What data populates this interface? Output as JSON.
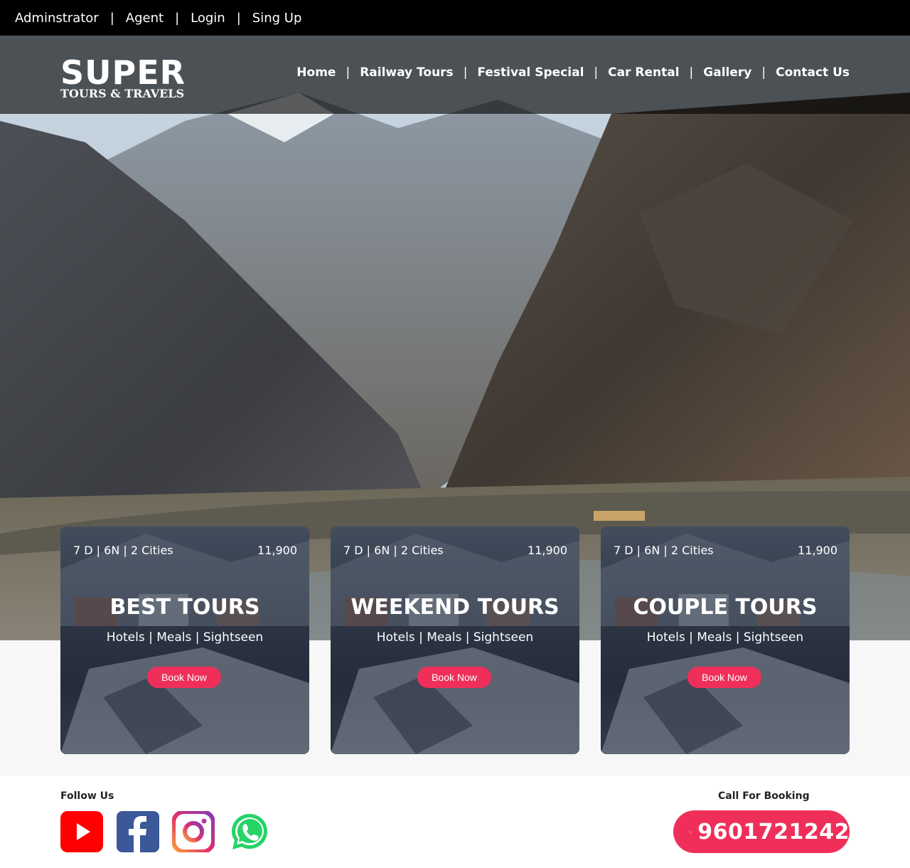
{
  "topbar": {
    "links": [
      "Adminstrator",
      "Agent",
      "Login",
      "Sing Up"
    ],
    "separator": "|"
  },
  "header": {
    "logo_main": "SUPER",
    "logo_sub": "TOURS & TRAVELS",
    "nav": [
      "Home",
      "Railway Tours",
      "Festival Special",
      "Car Rental",
      "Gallery",
      "Contact Us"
    ],
    "separator": "|"
  },
  "hero": {
    "image": "mountain-valley-photo"
  },
  "cards": [
    {
      "meta": "7 D | 6N | 2 Cities",
      "price": "11,900",
      "title": "BEST TOURS",
      "subtitle": "Hotels | Meals | Sightseen",
      "button": "Book Now"
    },
    {
      "meta": "7 D | 6N | 2 Cities",
      "price": "11,900",
      "title": "WEEKEND TOURS",
      "subtitle": "Hotels | Meals | Sightseen",
      "button": "Book Now"
    },
    {
      "meta": "7 D | 6N | 2 Cities",
      "price": "11,900",
      "title": "COUPLE TOURS",
      "subtitle": "Hotels | Meals | Sightseen",
      "button": "Book Now"
    }
  ],
  "footer": {
    "follow_label": "Follow Us",
    "social_icons": [
      "youtube-icon",
      "facebook-icon",
      "instagram-icon",
      "whatsapp-icon"
    ],
    "call_label": "Call For Booking",
    "phone": "9601721242"
  },
  "colors": {
    "accent": "#ef2f5a",
    "topbar": "#000000",
    "youtube": "#ff0000",
    "facebook": "#3b5998",
    "whatsapp": "#25d366"
  }
}
